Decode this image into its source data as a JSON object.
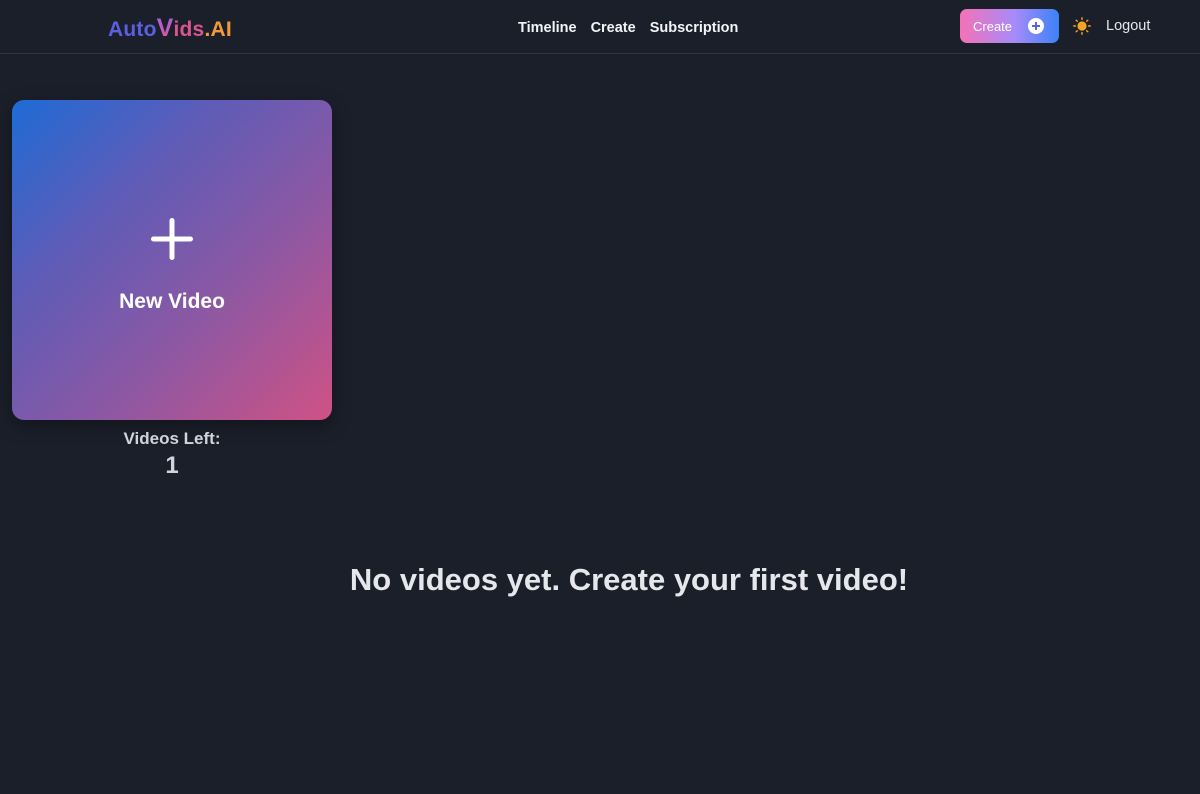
{
  "header": {
    "logo": {
      "part1": "Auto",
      "part2": "V",
      "part3": "ids",
      "part4": ".AI"
    },
    "nav": [
      {
        "label": "Timeline"
      },
      {
        "label": "Create"
      },
      {
        "label": "Subscription"
      }
    ],
    "create_button_label": "Create",
    "logout_label": "Logout",
    "theme_icon": "sun-icon"
  },
  "main": {
    "new_video_label": "New Video",
    "videos_left_label": "Videos Left:",
    "videos_left_count": "1",
    "empty_message": "No videos yet. Create your first video!"
  },
  "colors": {
    "background": "#1b1f2a",
    "sun": "#f5a524",
    "card_gradient_start": "#1e6bd6",
    "card_gradient_end": "#cf5285"
  }
}
